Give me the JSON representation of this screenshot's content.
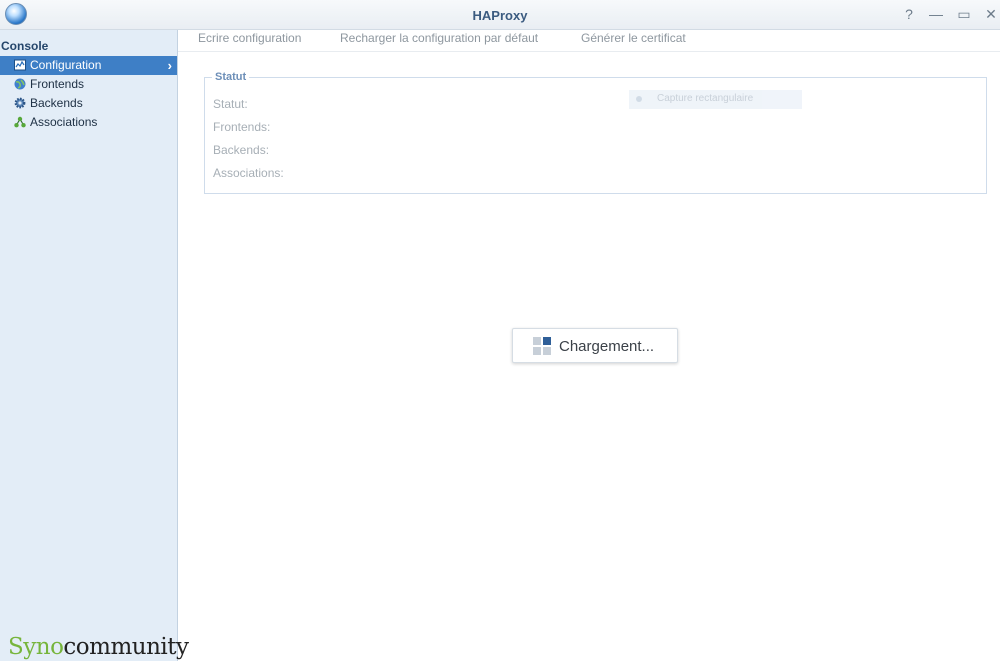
{
  "window": {
    "title": "HAProxy",
    "controls": {
      "help": "?",
      "minimize": "—",
      "maximize": "▭",
      "close": "✕"
    }
  },
  "sidebar": {
    "heading": "Console",
    "items": [
      {
        "label": "Configuration",
        "icon": "configuration-icon",
        "active": true
      },
      {
        "label": "Frontends",
        "icon": "frontends-globe-icon",
        "active": false
      },
      {
        "label": "Backends",
        "icon": "backends-gear-icon",
        "active": false
      },
      {
        "label": "Associations",
        "icon": "associations-network-icon",
        "active": false
      }
    ],
    "chevron": "›",
    "brand": {
      "part1": "Syno",
      "part2": "community"
    }
  },
  "toolbar": {
    "write_config": "Ecrire configuration",
    "reload_default": "Recharger la configuration par défaut",
    "generate_cert": "Générer le certificat"
  },
  "status_panel": {
    "legend": "Statut",
    "fields": [
      "Statut:",
      "Frontends:",
      "Backends:",
      "Associations:"
    ]
  },
  "capture_overlay": {
    "label": "Capture rectangulaire"
  },
  "loading": {
    "text": "Chargement..."
  },
  "colors": {
    "accent": "#3e7fc6",
    "sidebar_bg": "#e3edf7",
    "brand_green": "#77b53c",
    "title": "#3b5b80"
  }
}
